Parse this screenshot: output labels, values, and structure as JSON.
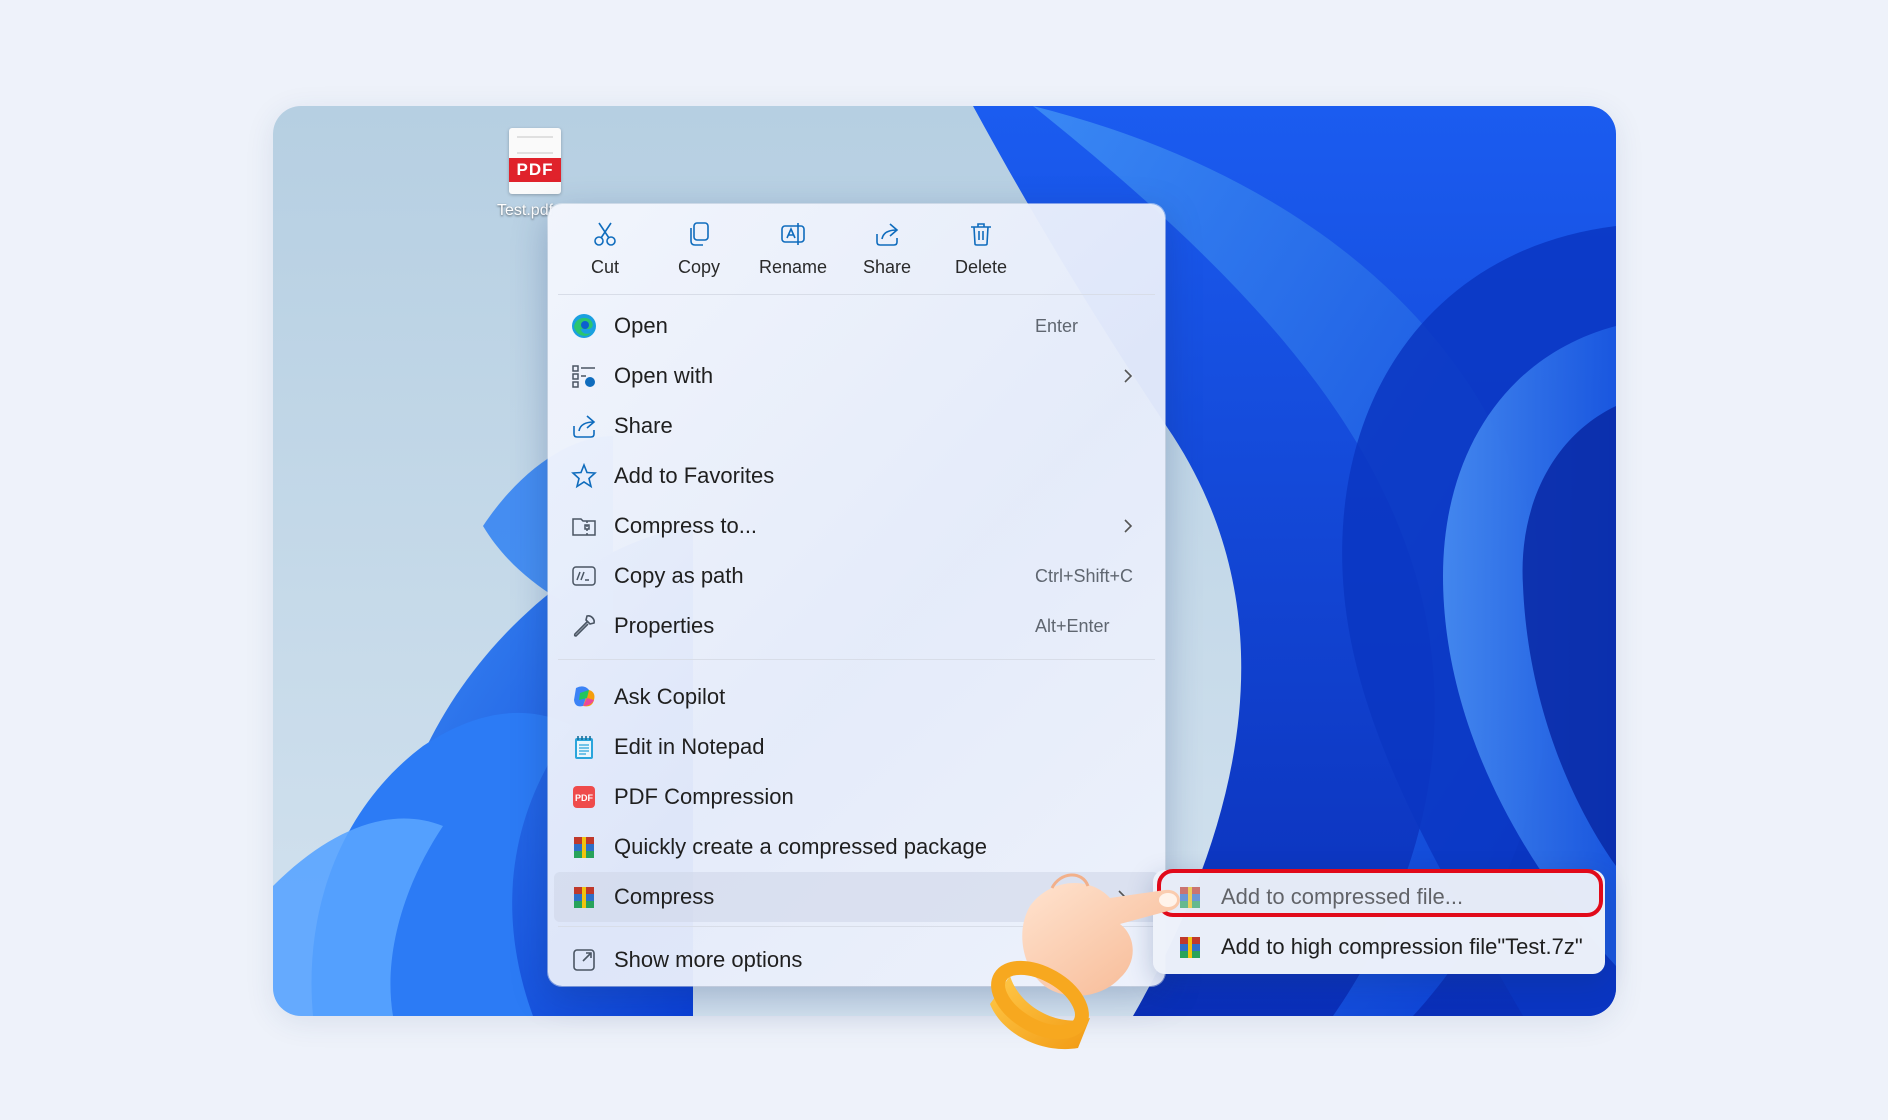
{
  "desktop": {
    "file_label": "Test.pdf",
    "badge": "PDF"
  },
  "quick_actions": [
    {
      "label": "Cut",
      "icon": "scissors-icon"
    },
    {
      "label": "Copy",
      "icon": "copy-icon"
    },
    {
      "label": "Rename",
      "icon": "rename-icon"
    },
    {
      "label": "Share",
      "icon": "share-icon"
    },
    {
      "label": "Delete",
      "icon": "trash-icon"
    }
  ],
  "menu": {
    "section1": [
      {
        "label": "Open",
        "shortcut": "Enter",
        "icon": "edge-icon"
      },
      {
        "label": "Open with",
        "submenu": true,
        "icon": "open-with-icon"
      },
      {
        "label": "Share",
        "icon": "share-icon"
      },
      {
        "label": "Add to Favorites",
        "icon": "star-icon"
      },
      {
        "label": "Compress to...",
        "submenu": true,
        "icon": "zip-folder-icon"
      },
      {
        "label": "Copy as path",
        "shortcut": "Ctrl+Shift+C",
        "icon": "path-icon"
      },
      {
        "label": "Properties",
        "shortcut": "Alt+Enter",
        "icon": "wrench-icon"
      }
    ],
    "section2": [
      {
        "label": "Ask Copilot",
        "icon": "copilot-icon"
      },
      {
        "label": "Edit in Notepad",
        "icon": "notepad-icon"
      },
      {
        "label": "PDF Compression",
        "icon": "pdf-icon"
      },
      {
        "label": "Quickly create a compressed package",
        "icon": "archive-icon"
      },
      {
        "label": "Compress",
        "submenu": true,
        "icon": "archive-icon"
      }
    ],
    "section3": [
      {
        "label": "Show more options",
        "icon": "more-options-icon"
      }
    ]
  },
  "submenu": [
    {
      "label": "Add to compressed file...",
      "highlighted": true
    },
    {
      "label": "Add to high compression file\"Test.7z\""
    }
  ],
  "colors": {
    "accent": "#0f6cbd",
    "highlight_border": "#e10a1a",
    "page_bg": "#eef2fa"
  }
}
